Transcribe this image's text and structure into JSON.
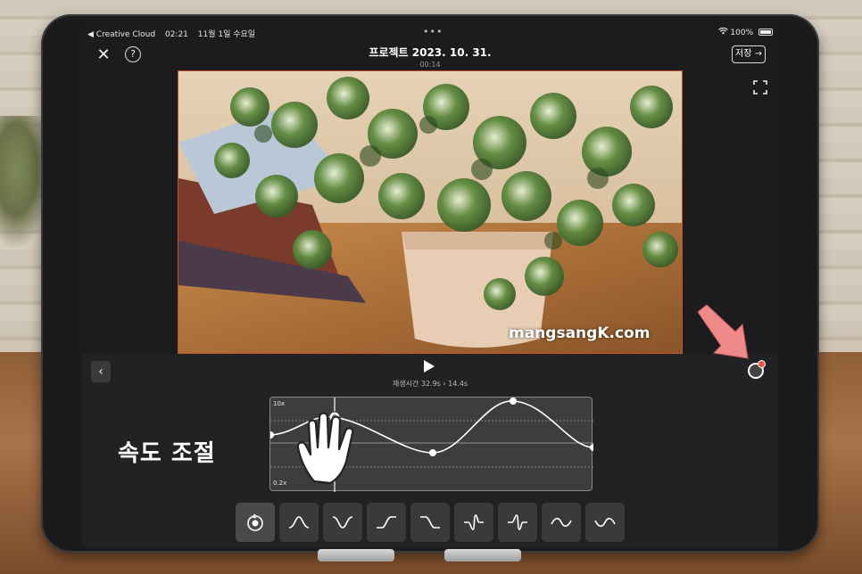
{
  "statusbar": {
    "back_app": "◀ Creative Cloud",
    "time": "02:21",
    "date": "11월 1일 수요일",
    "dots": "•••",
    "battery": "100%"
  },
  "topbar": {
    "title": "프로젝트 2023. 10. 31.",
    "duration": "00:14",
    "save_label": "저장 →"
  },
  "video": {
    "watermark": "mangsangK.com"
  },
  "controls": {
    "playtime": "재생시간 32.9s › 14.4s"
  },
  "graph": {
    "max_label": "10x",
    "min_label": "0.2x"
  },
  "annotation": {
    "label": "속도 조절"
  },
  "icons": {
    "close": "close-icon",
    "help": "help-icon",
    "fullscreen": "fullscreen-icon",
    "play": "play-icon",
    "back": "chevron-left-icon"
  },
  "colors": {
    "accent_arrow": "#f08a8a",
    "badge": "#e4553e"
  }
}
